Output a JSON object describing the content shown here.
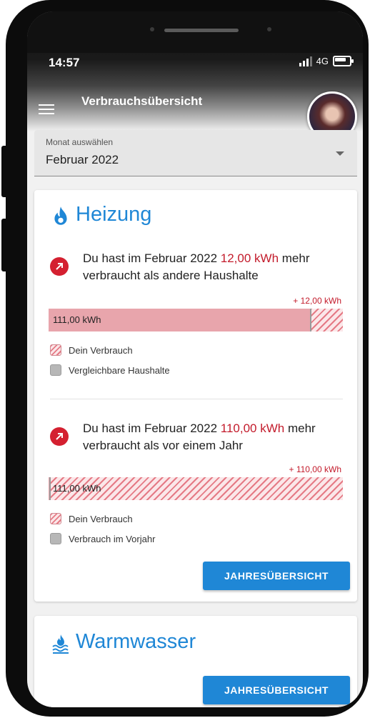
{
  "status_bar": {
    "time": "14:57",
    "network": "4G"
  },
  "app_bar": {
    "title": "Verbrauchsübersicht"
  },
  "month_select": {
    "label": "Monat auswählen",
    "value": "Februar 2022"
  },
  "heizung": {
    "title": "Heizung",
    "comparison_1": {
      "text_before": "Du hast im Februar 2022 ",
      "highlight": "12,00 kWh",
      "text_after": " mehr verbraucht als andere Haushalte",
      "delta_label": "+ 12,00 kWh",
      "bar_label": "111,00 kWh",
      "legend": [
        "Dein Verbrauch",
        "Vergleichbare Haushalte"
      ]
    },
    "comparison_2": {
      "text_before": "Du hast im Februar 2022 ",
      "highlight": "110,00 kWh",
      "text_after": " mehr verbraucht als vor einem Jahr",
      "delta_label": "+ 110,00 kWh",
      "bar_label": "111,00 kWh",
      "legend": [
        "Dein Verbrauch",
        "Verbrauch im Vorjahr"
      ]
    },
    "button_label": "JAHRESÜBERSICHT"
  },
  "warmwasser": {
    "title": "Warmwasser",
    "button_label": "JAHRESÜBERSICHT"
  },
  "colors": {
    "accent": "#1f87d6",
    "alert": "#c31b2b",
    "bar_fill": "#e8a5ac"
  }
}
